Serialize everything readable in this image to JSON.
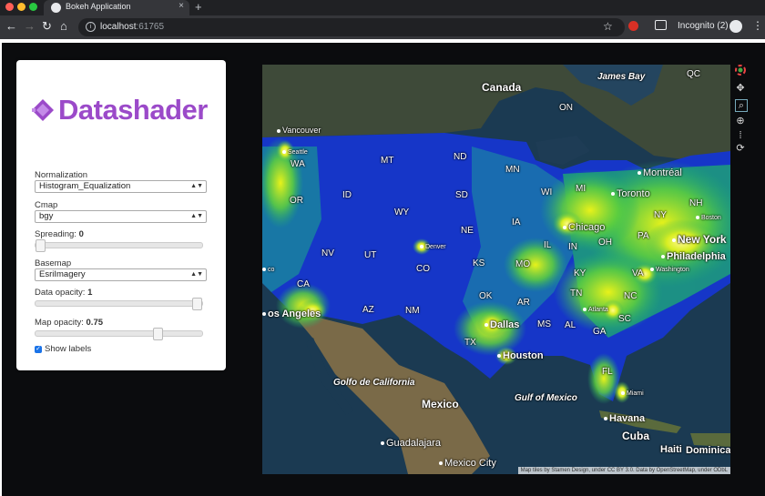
{
  "browser": {
    "tab_title": "Bokeh Application",
    "tab_close": "×",
    "new_tab": "+",
    "url_host": "localhost",
    "url_port": ":61765",
    "incognito_label": "Incognito (2)",
    "back": "←",
    "forward": "→",
    "reload": "↻",
    "home": "⌂",
    "star": "☆",
    "menu": "⋮"
  },
  "logo": {
    "text": "Datashader",
    "color": "#9b4ac9"
  },
  "controls": {
    "normalization": {
      "label": "Normalization",
      "value": "Histogram_Equalization"
    },
    "cmap": {
      "label": "Cmap",
      "value": "bgy"
    },
    "spreading": {
      "label": "Spreading:",
      "value": "0",
      "level": 0
    },
    "basemap": {
      "label": "Basemap",
      "value": "EsriImagery"
    },
    "data_opacity": {
      "label": "Data opacity:",
      "value": "1",
      "level": 1
    },
    "map_opacity": {
      "label": "Map opacity:",
      "value": "0.75",
      "level": 0.75
    },
    "show_labels": {
      "label": "Show labels",
      "checked": true
    }
  },
  "map": {
    "attribution": "Map tiles by Stamen Design, under CC BY 3.0. Data by OpenStreetMap, under ODbL",
    "labels": {
      "canada": "Canada",
      "james_bay": "James Bay",
      "qc": "QC",
      "on": "ON",
      "vancouver": "Vancouver",
      "seattle": "Seattle",
      "wa": "WA",
      "mt": "MT",
      "nd": "ND",
      "mn": "MN",
      "montreal": "Montréal",
      "toronto": "Toronto",
      "nh": "NH",
      "wi": "WI",
      "mi": "MI",
      "or": "OR",
      "id": "ID",
      "sd": "SD",
      "ny": "NY",
      "boston": "Boston",
      "wy": "WY",
      "ia": "IA",
      "chicago": "Chicago",
      "ne": "NE",
      "oh": "OH",
      "pa": "PA",
      "new_york": "New York",
      "il": "IL",
      "in": "IN",
      "nv": "NV",
      "ut": "UT",
      "denver": "Denver",
      "philadelphia": "Philadelphia",
      "co": "CO",
      "ks": "KS",
      "mo": "MO",
      "ky": "KY",
      "va": "VA",
      "washington": "Washington",
      "ca": "CA",
      "sf_fragment": "co",
      "tn": "TN",
      "nc": "NC",
      "ok": "OK",
      "ar": "AR",
      "los_angeles": "os Angeles",
      "az": "AZ",
      "nm": "NM",
      "atlanta": "Atlanta",
      "sc": "SC",
      "dallas": "Dallas",
      "ms": "MS",
      "al": "AL",
      "ga": "GA",
      "tx": "TX",
      "houston": "Houston",
      "fl": "FL",
      "golfo": "Golfo de California",
      "gulf": "Gulf of Mexico",
      "miami": "Miami",
      "mexico": "Mexico",
      "havana": "Havana",
      "cuba": "Cuba",
      "haiti": "Haiti",
      "dominican": "Dominicar",
      "guadalajara": "Guadalajara",
      "mexico_city": "Mexico City"
    }
  },
  "colors": {
    "ocean": "#1b3a52",
    "land": "#4a5a3c",
    "data_low": "#1636c8",
    "data_mid": "#1fae6e",
    "data_high": "#e8f21a"
  },
  "tool_icons": [
    "bokeh-logo-icon",
    "pan-icon",
    "box-zoom-icon",
    "wheel-zoom-icon",
    "hover-icon",
    "reset-icon"
  ]
}
